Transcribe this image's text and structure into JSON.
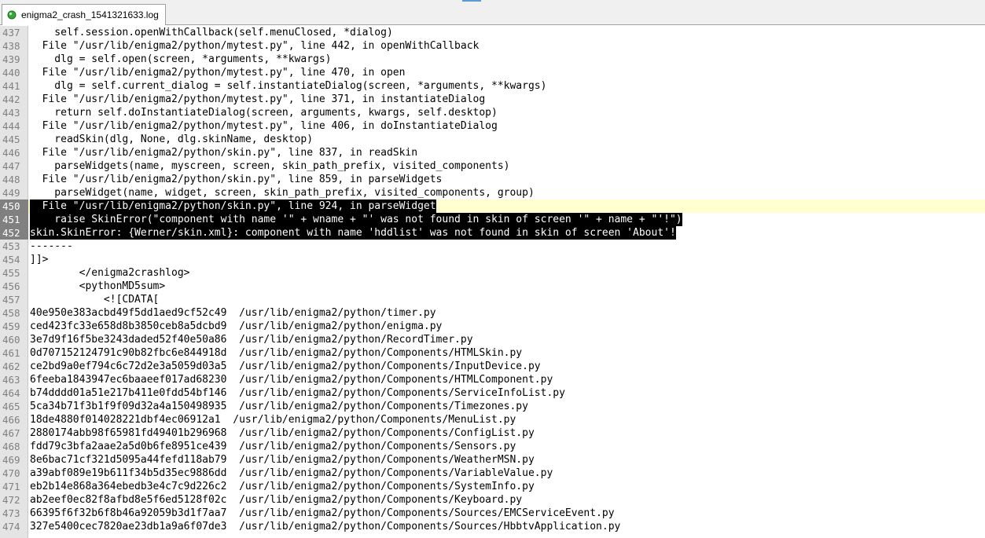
{
  "tab": {
    "title": "enigma2_crash_1541321633.log"
  },
  "colors": {
    "selection_bg": "#000000",
    "selection_fg": "#ffffff",
    "current_line_bg": "#ffffd0",
    "gutter_bg": "#e4e4e4"
  },
  "editor": {
    "lines": [
      {
        "n": "437",
        "text": "    self.session.openWithCallback(self.menuClosed, *dialog)"
      },
      {
        "n": "438",
        "text": "  File \"/usr/lib/enigma2/python/mytest.py\", line 442, in openWithCallback"
      },
      {
        "n": "439",
        "text": "    dlg = self.open(screen, *arguments, **kwargs)"
      },
      {
        "n": "440",
        "text": "  File \"/usr/lib/enigma2/python/mytest.py\", line 470, in open"
      },
      {
        "n": "441",
        "text": "    dlg = self.current_dialog = self.instantiateDialog(screen, *arguments, **kwargs)"
      },
      {
        "n": "442",
        "text": "  File \"/usr/lib/enigma2/python/mytest.py\", line 371, in instantiateDialog"
      },
      {
        "n": "443",
        "text": "    return self.doInstantiateDialog(screen, arguments, kwargs, self.desktop)"
      },
      {
        "n": "444",
        "text": "  File \"/usr/lib/enigma2/python/mytest.py\", line 406, in doInstantiateDialog"
      },
      {
        "n": "445",
        "text": "    readSkin(dlg, None, dlg.skinName, desktop)"
      },
      {
        "n": "446",
        "text": "  File \"/usr/lib/enigma2/python/skin.py\", line 837, in readSkin"
      },
      {
        "n": "447",
        "text": "    parseWidgets(name, myscreen, screen, skin_path_prefix, visited_components)"
      },
      {
        "n": "448",
        "text": "  File \"/usr/lib/enigma2/python/skin.py\", line 859, in parseWidgets"
      },
      {
        "n": "449",
        "text": "    parseWidget(name, widget, screen, skin_path_prefix, visited_components, group)"
      },
      {
        "n": "450",
        "text": "  File \"/usr/lib/enigma2/python/skin.py\", line 924, in parseWidget",
        "state": "current-sel"
      },
      {
        "n": "451",
        "text": "    raise SkinError(\"component with name '\" + wname + \"' was not found in skin of screen '\" + name + \"'!\")",
        "state": "sel"
      },
      {
        "n": "452",
        "text": "skin.SkinError: {Werner/skin.xml}: component with name 'hddlist' was not found in skin of screen 'About'!",
        "state": "sel"
      },
      {
        "n": "453",
        "text": "-------"
      },
      {
        "n": "454",
        "text": "]]>"
      },
      {
        "n": "455",
        "text": "        </enigma2crashlog>"
      },
      {
        "n": "456",
        "text": "        <pythonMD5sum>"
      },
      {
        "n": "457",
        "text": "            <![CDATA["
      },
      {
        "n": "458",
        "text": "40e950e383acbd49f5dd1aed9cf52c49  /usr/lib/enigma2/python/timer.py"
      },
      {
        "n": "459",
        "text": "ced423fc33e658d8b3850ceb8a5dcbd9  /usr/lib/enigma2/python/enigma.py"
      },
      {
        "n": "460",
        "text": "3e7d9f16f5be3243daded52f40e50a86  /usr/lib/enigma2/python/RecordTimer.py"
      },
      {
        "n": "461",
        "text": "0d707152124791c90b82fbc6e844918d  /usr/lib/enigma2/python/Components/HTMLSkin.py"
      },
      {
        "n": "462",
        "text": "ce2bd9a0ef794c6c72d2e3a5059d03a5  /usr/lib/enigma2/python/Components/InputDevice.py"
      },
      {
        "n": "463",
        "text": "6feeba1843947ec6baaeef017ad68230  /usr/lib/enigma2/python/Components/HTMLComponent.py"
      },
      {
        "n": "464",
        "text": "b74dddd01a51e217b411e0fdd54bf146  /usr/lib/enigma2/python/Components/ServiceInfoList.py"
      },
      {
        "n": "465",
        "text": "5ca34b71f3b1f9f09d32a4a150498935  /usr/lib/enigma2/python/Components/Timezones.py"
      },
      {
        "n": "466",
        "text": "18de4880f014028221dbf4ec06912a1  /usr/lib/enigma2/python/Components/MenuList.py"
      },
      {
        "n": "467",
        "text": "2880174abb98f65981fd49401b296968  /usr/lib/enigma2/python/Components/ConfigList.py"
      },
      {
        "n": "468",
        "text": "fdd79c3bfa2aae2a5d0b6fe8951ce439  /usr/lib/enigma2/python/Components/Sensors.py"
      },
      {
        "n": "469",
        "text": "8e6bac71cf321d5095a44fefd118ab79  /usr/lib/enigma2/python/Components/WeatherMSN.py"
      },
      {
        "n": "470",
        "text": "a39abf089e19b611f34b5d35ec9886dd  /usr/lib/enigma2/python/Components/VariableValue.py"
      },
      {
        "n": "471",
        "text": "eb2b14e868a364ebedb3e4c7c9d226c2  /usr/lib/enigma2/python/Components/SystemInfo.py"
      },
      {
        "n": "472",
        "text": "ab2eef0ec82f8afbd8e5f6ed5128f02c  /usr/lib/enigma2/python/Components/Keyboard.py"
      },
      {
        "n": "473",
        "text": "66395f6f32b6f8b46a92059b3d1f7aa7  /usr/lib/enigma2/python/Components/Sources/EMCServiceEvent.py"
      },
      {
        "n": "474",
        "text": "327e5400cec7820ae23db1a9a6f07de3  /usr/lib/enigma2/python/Components/Sources/HbbtvApplication.py"
      }
    ]
  }
}
